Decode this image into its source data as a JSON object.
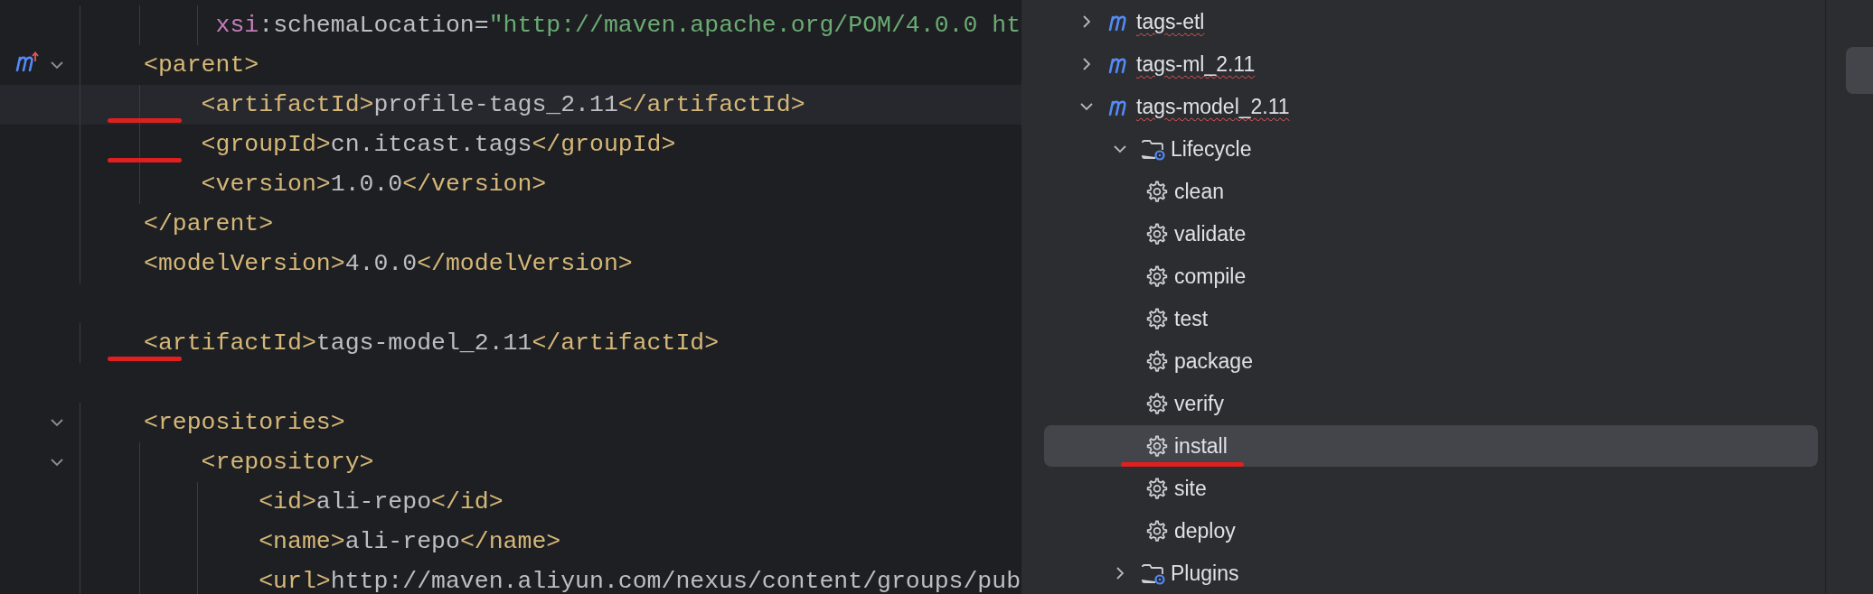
{
  "editor": {
    "blocks": [
      {
        "lines": [
          {
            "current": false,
            "fold": false,
            "module_marker": false,
            "marked": false,
            "tokens": [
              {
                "kind": "ns",
                "text": "     xsi"
              },
              {
                "kind": "plain",
                "text": ":"
              },
              {
                "kind": "attr",
                "text": "schemaLocation"
              },
              {
                "kind": "plain",
                "text": "="
              },
              {
                "kind": "string",
                "text": "\"http://maven.apache.org/POM/4.0.0 ht"
              }
            ]
          },
          {
            "current": false,
            "fold": true,
            "module_marker": true,
            "marked": false,
            "tokens": [
              {
                "kind": "tag",
                "text": "<parent>"
              }
            ]
          },
          {
            "current": true,
            "fold": false,
            "module_marker": false,
            "marked": true,
            "tokens": [
              {
                "kind": "tag",
                "text": "    <artifactId>"
              },
              {
                "kind": "plain",
                "text": "profile-tags_2.11"
              },
              {
                "kind": "tag",
                "text": "</artifactId>"
              }
            ]
          },
          {
            "current": false,
            "fold": false,
            "module_marker": false,
            "marked": true,
            "tokens": [
              {
                "kind": "tag",
                "text": "    <groupId>"
              },
              {
                "kind": "plain",
                "text": "cn.itcast.tags"
              },
              {
                "kind": "tag",
                "text": "</groupId>"
              }
            ]
          },
          {
            "current": false,
            "fold": false,
            "module_marker": false,
            "marked": false,
            "tokens": [
              {
                "kind": "tag",
                "text": "    <version>"
              },
              {
                "kind": "plain",
                "text": "1.0.0"
              },
              {
                "kind": "tag",
                "text": "</version>"
              }
            ]
          },
          {
            "current": false,
            "fold": false,
            "module_marker": false,
            "marked": false,
            "tokens": [
              {
                "kind": "tag",
                "text": "</parent>"
              }
            ]
          },
          {
            "current": false,
            "fold": false,
            "module_marker": false,
            "marked": false,
            "tokens": [
              {
                "kind": "tag",
                "text": "<modelVersion>"
              },
              {
                "kind": "plain",
                "text": "4.0.0"
              },
              {
                "kind": "tag",
                "text": "</modelVersion>"
              }
            ]
          }
        ]
      },
      {
        "lines": [
          {
            "current": false,
            "fold": false,
            "module_marker": false,
            "marked": true,
            "tokens": [
              {
                "kind": "tag",
                "text": "<artifactId>"
              },
              {
                "kind": "plain",
                "text": "tags-model_2.11"
              },
              {
                "kind": "tag",
                "text": "</artifactId>"
              }
            ]
          }
        ]
      },
      {
        "lines": [
          {
            "current": false,
            "fold": true,
            "module_marker": false,
            "marked": false,
            "tokens": [
              {
                "kind": "tag",
                "text": "<repositories>"
              }
            ]
          },
          {
            "current": false,
            "fold": true,
            "module_marker": false,
            "marked": false,
            "tokens": [
              {
                "kind": "tag",
                "text": "    <repository>"
              }
            ]
          },
          {
            "current": false,
            "fold": false,
            "module_marker": false,
            "marked": false,
            "tokens": [
              {
                "kind": "tag",
                "text": "        <id>"
              },
              {
                "kind": "plain",
                "text": "ali-repo"
              },
              {
                "kind": "tag",
                "text": "</id>"
              }
            ]
          },
          {
            "current": false,
            "fold": false,
            "module_marker": false,
            "marked": false,
            "tokens": [
              {
                "kind": "tag",
                "text": "        <name>"
              },
              {
                "kind": "plain",
                "text": "ali-repo"
              },
              {
                "kind": "tag",
                "text": "</name>"
              }
            ]
          },
          {
            "current": false,
            "fold": false,
            "module_marker": false,
            "marked": false,
            "tokens": [
              {
                "kind": "tag",
                "text": "        <url>"
              },
              {
                "kind": "plain",
                "text": "http://maven.aliyun.com/nexus/content/groups/pub"
              }
            ]
          }
        ]
      }
    ]
  },
  "maven_tree": {
    "items": [
      {
        "kind": "module",
        "label": "tags-etl",
        "expanded": false,
        "selected": false,
        "spelling_error": true,
        "marked": false
      },
      {
        "kind": "module",
        "label": "tags-ml_2.11",
        "expanded": false,
        "selected": false,
        "spelling_error": true,
        "marked": false
      },
      {
        "kind": "module",
        "label": "tags-model_2.11",
        "expanded": true,
        "selected": false,
        "spelling_error": true,
        "marked": false,
        "children": [
          {
            "kind": "folder",
            "label": "Lifecycle",
            "expanded": true,
            "selected": false,
            "spelling_error": false,
            "marked": false,
            "children": [
              {
                "kind": "goal",
                "label": "clean",
                "selected": false,
                "spelling_error": false,
                "marked": false
              },
              {
                "kind": "goal",
                "label": "validate",
                "selected": false,
                "spelling_error": false,
                "marked": false
              },
              {
                "kind": "goal",
                "label": "compile",
                "selected": false,
                "spelling_error": false,
                "marked": false
              },
              {
                "kind": "goal",
                "label": "test",
                "selected": false,
                "spelling_error": false,
                "marked": false
              },
              {
                "kind": "goal",
                "label": "package",
                "selected": false,
                "spelling_error": false,
                "marked": false
              },
              {
                "kind": "goal",
                "label": "verify",
                "selected": false,
                "spelling_error": false,
                "marked": false
              },
              {
                "kind": "goal",
                "label": "install",
                "selected": true,
                "spelling_error": false,
                "marked": true
              },
              {
                "kind": "goal",
                "label": "site",
                "selected": false,
                "spelling_error": false,
                "marked": false
              },
              {
                "kind": "goal",
                "label": "deploy",
                "selected": false,
                "spelling_error": false,
                "marked": false
              }
            ]
          },
          {
            "kind": "folder",
            "label": "Plugins",
            "expanded": false,
            "selected": false,
            "spelling_error": false,
            "marked": false
          }
        ]
      }
    ]
  }
}
